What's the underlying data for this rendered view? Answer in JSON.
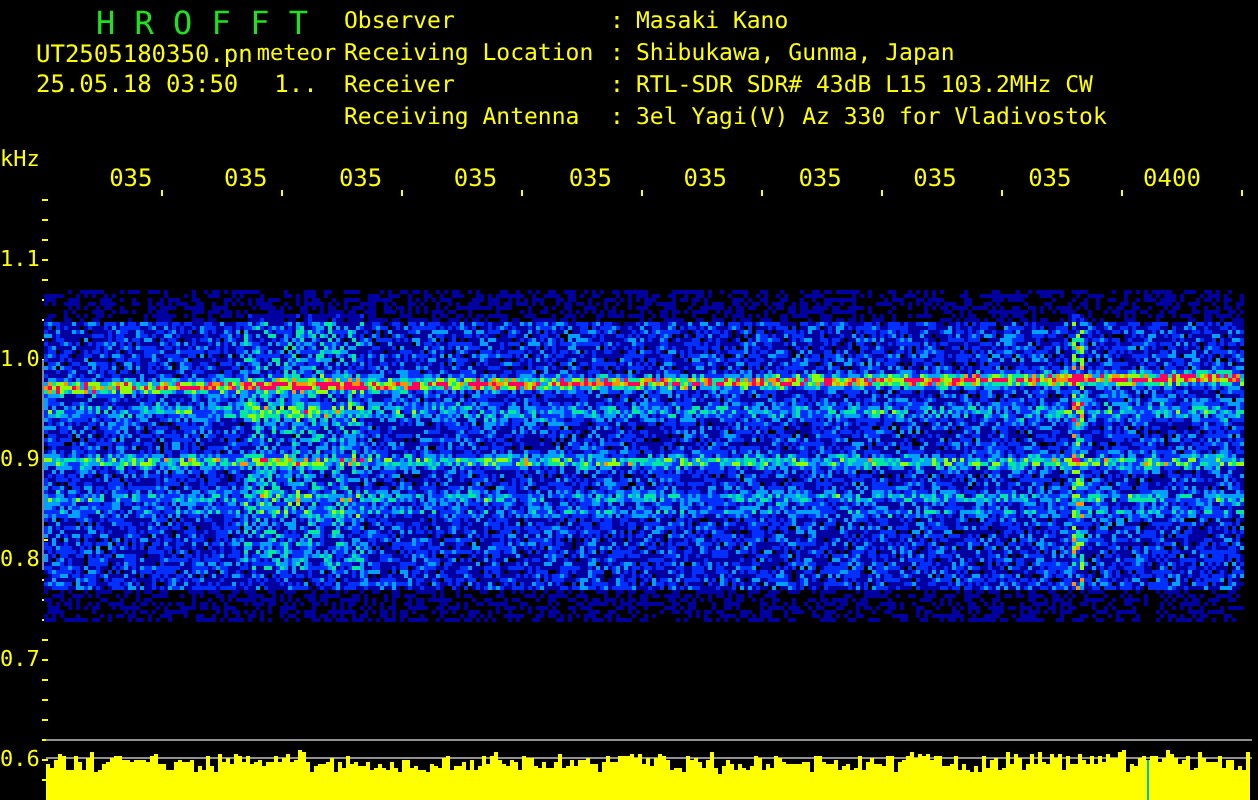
{
  "header": {
    "title": "H R O F F T",
    "file_name": "UT2505180350.pn",
    "tag": "meteor",
    "datetime": "25.05.18 03:50",
    "status": "1.."
  },
  "info": [
    {
      "label": "Observer",
      "separator": ":",
      "value": "Masaki Kano"
    },
    {
      "label": "Receiving Location",
      "separator": ":",
      "value": "Shibukawa, Gunma, Japan"
    },
    {
      "label": "Receiver",
      "separator": ":",
      "value": "RTL-SDR SDR# 43dB L15 103.2MHz CW"
    },
    {
      "label": "Receiving Antenna",
      "separator": ":",
      "value": "3el Yagi(V) Az 330 for Vladivostok"
    }
  ],
  "axis": {
    "unit": "kHz",
    "time_labels": [
      "035",
      "035",
      "035",
      "035",
      "035",
      "035",
      "035",
      "035",
      "035",
      "0400"
    ],
    "frequency_labels": [
      "1.1",
      "1.0",
      "0.9",
      "0.8",
      "0.7",
      "0.6"
    ]
  }
}
